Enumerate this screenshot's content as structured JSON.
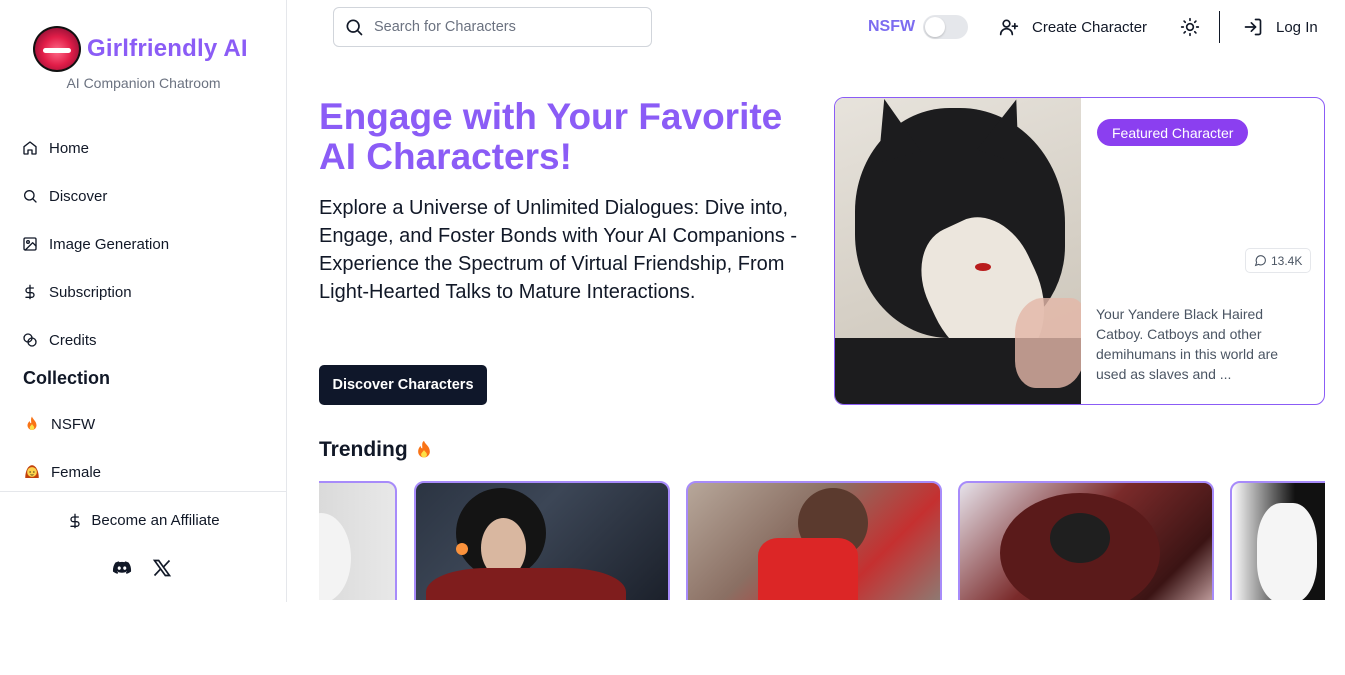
{
  "brand": {
    "name": "Girlfriendly AI",
    "tagline": "AI Companion Chatroom"
  },
  "sidebar": {
    "nav": [
      {
        "label": "Home",
        "icon": "home-icon"
      },
      {
        "label": "Discover",
        "icon": "search-icon"
      },
      {
        "label": "Image Generation",
        "icon": "image-icon"
      },
      {
        "label": "Subscription",
        "icon": "dollar-icon"
      },
      {
        "label": "Credits",
        "icon": "coins-icon"
      }
    ],
    "collection_title": "Collection",
    "collection": [
      {
        "label": "NSFW",
        "icon": "fire-emoji-icon"
      },
      {
        "label": "Female",
        "icon": "woman-emoji-icon"
      }
    ],
    "affiliate_label": "Become an Affiliate",
    "socials": [
      "discord-icon",
      "x-icon"
    ]
  },
  "header": {
    "search_placeholder": "Search for Characters",
    "nsfw_label": "NSFW",
    "nsfw_enabled": false,
    "create_label": "Create Character",
    "login_label": "Log In"
  },
  "hero": {
    "title": "Engage with Your Favorite AI Characters!",
    "description": "Explore a Universe of Unlimited Dialogues: Dive into, Engage, and Foster Bonds with Your AI Companions - Experience the Spectrum of Virtual Friendship, From Light-Hearted Talks to Mature Interactions.",
    "button_label": "Discover Characters"
  },
  "featured": {
    "badge": "Featured Character",
    "message_count": "13.4K",
    "description": "Your Yandere Black Haired Catboy. Catboys and other demihumans in this world are used as slaves and ..."
  },
  "trending": {
    "title": "Trending",
    "cards": [
      "card-1",
      "card-2",
      "card-3",
      "card-4",
      "card-5"
    ]
  },
  "colors": {
    "accent": "#8b5cf6",
    "button_dark": "#0f172a",
    "badge": "#8b3ff0"
  }
}
